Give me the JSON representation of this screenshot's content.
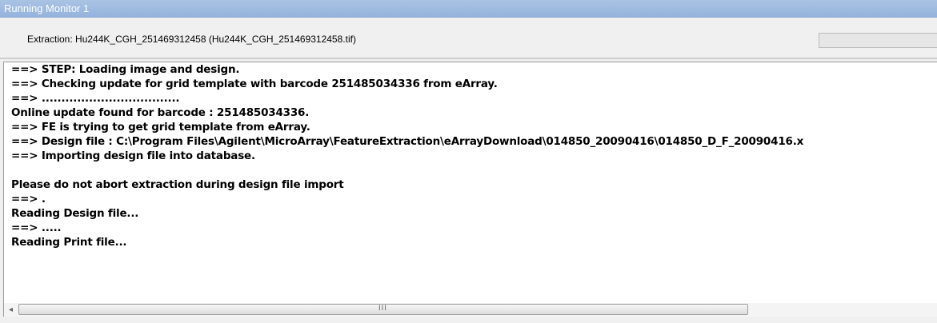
{
  "window": {
    "title": "Running Monitor 1"
  },
  "header": {
    "extraction_label": "Extraction: Hu244K_CGH_251469312458 (Hu244K_CGH_251469312458.tif)"
  },
  "log": {
    "lines": [
      "==> STEP: Loading image and design.",
      "==> Checking update for grid template with barcode 251485034336 from eArray.",
      "==> ...................................",
      "Online update found for barcode : 251485034336.",
      "==> FE is trying to get grid template from eArray.",
      "==> Design file : C:\\Program Files\\Agilent\\MicroArray\\FeatureExtraction\\eArrayDownload\\014850_20090416\\014850_D_F_20090416.x",
      "==> Importing design file into database.",
      "",
      "Please do not abort extraction during design file import",
      "==> .",
      "Reading Design file...",
      "==> .....",
      "Reading Print file..."
    ]
  },
  "scrollbar": {
    "left_arrow": "◂",
    "grip": "III"
  }
}
